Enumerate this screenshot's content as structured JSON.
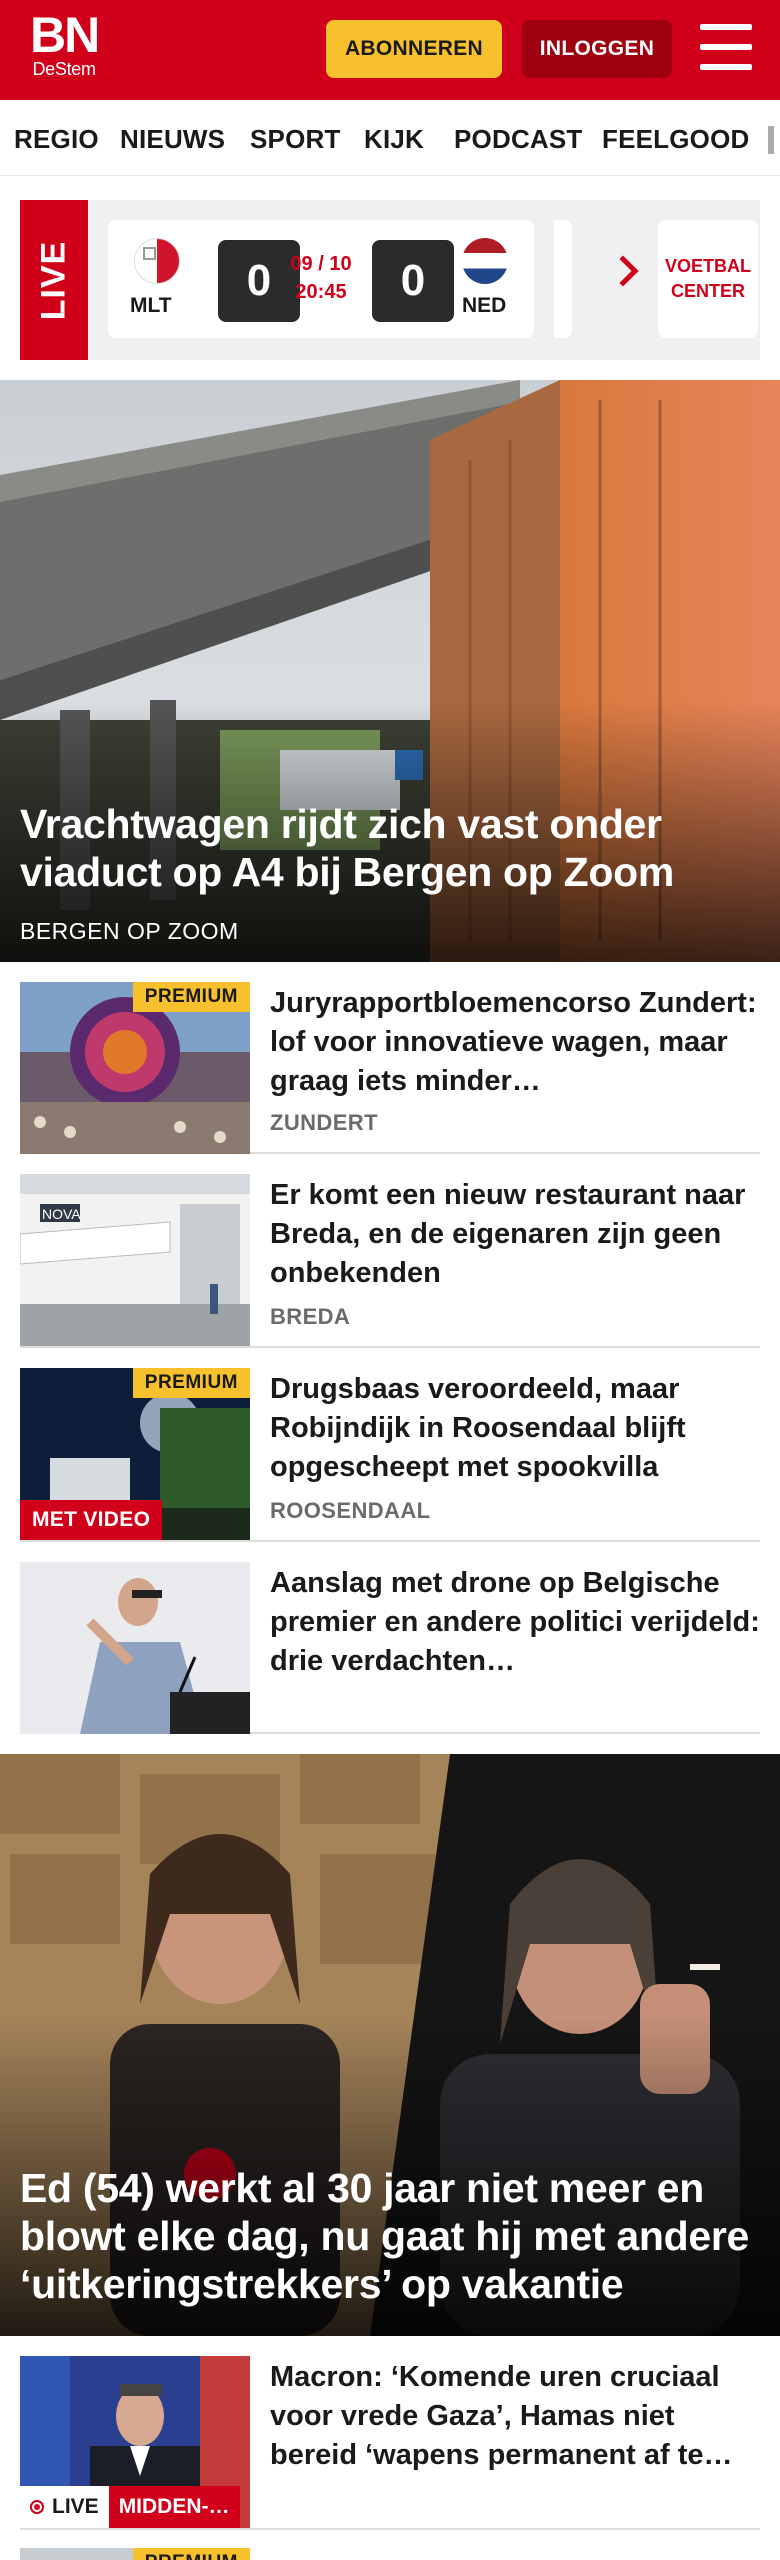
{
  "header": {
    "logo_main": "BN",
    "logo_sub": "DeStem",
    "subscribe_label": "ABONNEREN",
    "login_label": "INLOGGEN",
    "brand_color": "#d1001a"
  },
  "nav": {
    "items": [
      "REGIO",
      "NIEUWS",
      "SPORT",
      "KIJK",
      "PODCAST",
      "FEELGOOD"
    ]
  },
  "live_widget": {
    "tag": "LIVE",
    "match": {
      "home": "MLT",
      "home_score": "0",
      "away": "NED",
      "away_score": "0",
      "date": "09 / 10",
      "time": "20:45"
    },
    "voetbal_center_line1": "VOETBAL",
    "voetbal_center_line2": "CENTER"
  },
  "hero1": {
    "title": "Vrachtwagen rijdt zich vast onder viaduct op A4 bij Bergen op Zoom",
    "location": "BERGEN OP ZOOM"
  },
  "articles": [
    {
      "title": "Juryrapportbloemencorso Zundert: lof voor innovatieve wagen, maar graag iets minder…",
      "location": "ZUNDERT",
      "premium": "PREMIUM"
    },
    {
      "title": "Er komt een nieuw restaurant naar Breda, en de eigenaren zijn geen onbekenden",
      "location": "BREDA",
      "sign": "NOVA"
    },
    {
      "title": "Drugsbaas veroordeeld, maar Robijndijk in Roosendaal blijft opgescheept met spookvilla",
      "location": "ROOSENDAAL",
      "premium": "PREMIUM",
      "video_tag": "MET VIDEO"
    },
    {
      "title": "Aanslag met drone op Belgische premier en andere politici verijdeld: drie verdachten…"
    }
  ],
  "hero2": {
    "title": "Ed (54) werkt al 30 jaar niet meer en blowt elke dag, nu gaat hij met andere ‘uitkeringstrekkers’ op vakantie"
  },
  "article_live": {
    "title": "Macron: ‘Komende uren cruciaal voor vrede Gaza’, Hamas niet bereid ‘wapens permanent af te…",
    "live_label": "LIVE",
    "category": "MIDDEN-…"
  },
  "article_partial": {
    "premium": "PREMIUM"
  }
}
